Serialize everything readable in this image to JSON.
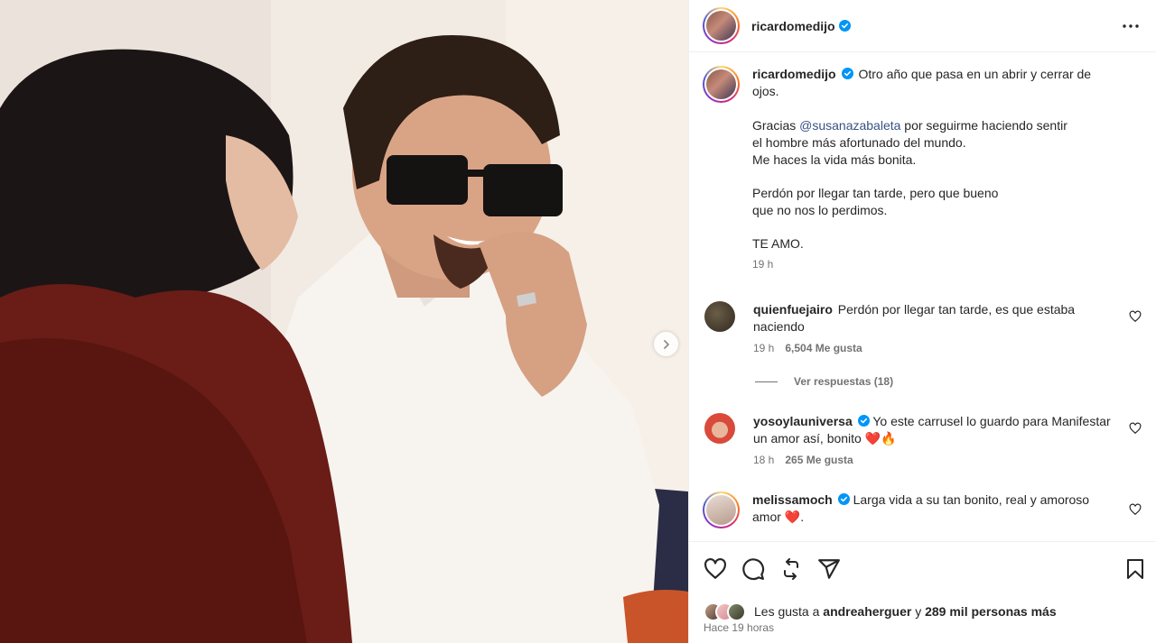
{
  "post": {
    "author": "ricardomedijo",
    "caption_lines": [
      "Otro año que pasa en un abrir y cerrar de",
      "ojos."
    ],
    "caption_p2_pre": "Gracias ",
    "caption_p2_mention": "@susanazabaleta",
    "caption_p2_post": " por seguirme haciendo sentir",
    "caption_p2_line2": "el hombre más afortunado del mundo.",
    "caption_p2_line3": "Me haces la vida más bonita.",
    "caption_p3_line1": "Perdón por llegar tan tarde, pero que bueno",
    "caption_p3_line2": "que no nos lo perdimos.",
    "caption_p4": "TE AMO.",
    "caption_time": "19 h"
  },
  "comments": [
    {
      "user": "quienfuejairo",
      "verified": false,
      "text": "Perdón por llegar tan tarde, es que estaba naciendo",
      "time": "19 h",
      "likes": "6,504 Me gusta",
      "avatar_color": "#4a4032"
    },
    {
      "user": "yosoylauniversa",
      "verified": true,
      "text": "Yo este carrusel lo guardo para Manifestar un amor así, bonito ❤️🔥",
      "time": "18 h",
      "likes": "265 Me gusta",
      "avatar_color": "#d94a3a"
    },
    {
      "user": "melissamoch",
      "verified": true,
      "text": "Larga vida a su tan bonito, real y amoroso amor ❤️.",
      "avatar_color": "#c8b9b0"
    }
  ],
  "replies_label": "Ver respuestas (18)",
  "likes": {
    "prefix": "Les gusta a ",
    "user": "andreaherguer",
    "mid": " y ",
    "count": "289 mil personas más"
  },
  "posted_ago": "Hace 19 horas",
  "icons": {
    "like": "heart-icon",
    "comment": "comment-icon",
    "repost": "repost-icon",
    "share": "share-icon",
    "save": "bookmark-icon",
    "more": "more-icon",
    "next": "chevron-right-icon",
    "verified": "verified-badge-icon"
  },
  "colors": {
    "verified_blue": "#0095f6",
    "mention": "#385185",
    "secondary_text": "#737373"
  }
}
